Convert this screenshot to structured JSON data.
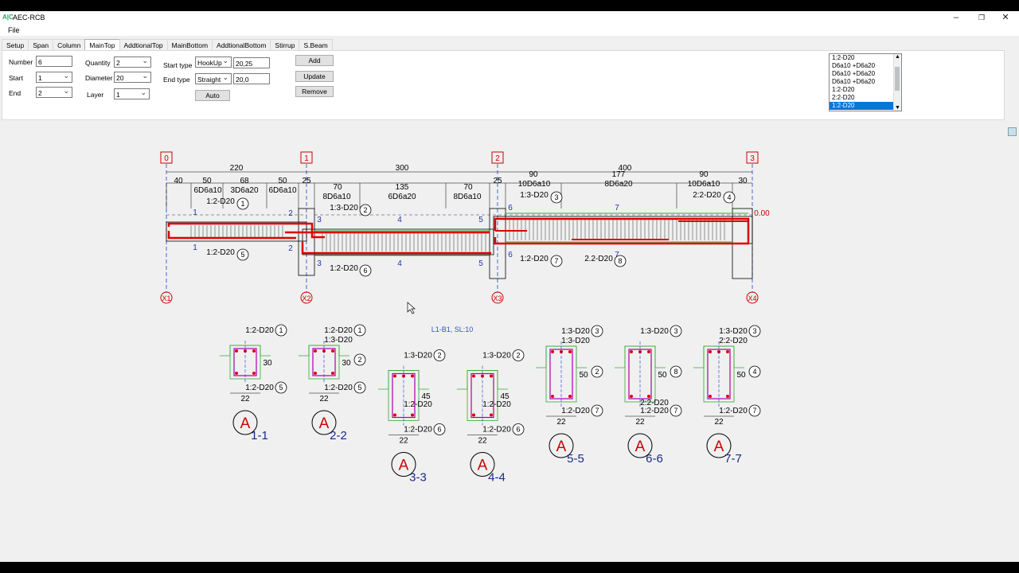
{
  "window": {
    "title": "AEC-RCB",
    "icon_text": "A|C"
  },
  "menu": {
    "file": "File"
  },
  "tabs": [
    "Setup",
    "Span",
    "Column",
    "MainTop",
    "AddtionalTop",
    "MainBottom",
    "AddtionalBottom",
    "Stirrup",
    "S.Beam"
  ],
  "active_tab": "MainTop",
  "form": {
    "number_label": "Number",
    "number_value": "6",
    "start_label": "Start",
    "start_value": "1",
    "end_label": "End",
    "end_value": "2",
    "quantity_label": "Quantity",
    "quantity_value": "2",
    "diameter_label": "Diameter",
    "diameter_value": "20",
    "layer_label": "Layer",
    "layer_value": "1",
    "start_type_label": "Start type",
    "start_type_value": "HookUp",
    "start_type_text": "20,25",
    "end_type_label": "End type",
    "end_type_value": "Straight",
    "end_type_text": "20,0",
    "auto_button": "Auto",
    "add_button": "Add",
    "update_button": "Update",
    "remove_button": "Remove"
  },
  "list_items": [
    "1:2-D20",
    "D6a10 +D6a20",
    "D6a10 +D6a20",
    "D6a10 +D6a20",
    "1:2-D20",
    "2:2-D20",
    "1:2-D20"
  ],
  "list_selected_index": 6,
  "drawing": {
    "grid_labels": [
      "0",
      "1",
      "2",
      "3"
    ],
    "axis_labels": [
      "X1",
      "X2",
      "X3",
      "X4"
    ],
    "span_dims": [
      "220",
      "300",
      "400"
    ],
    "sub_dims_1": [
      "40",
      "50",
      "68",
      "50",
      "25"
    ],
    "sub_dims_2": [
      "70",
      "135",
      "70",
      "25"
    ],
    "sub_dims_3": [
      "90",
      "177",
      "90",
      "30"
    ],
    "stirrup_labels": [
      "6D6a10",
      "3D6a20",
      "6D6a10",
      "8D6a10",
      "6D6a20",
      "8D6a10",
      "10D6a10",
      "8D6a20",
      "10D6a10"
    ],
    "level_text": "0.00",
    "rebar_labels": [
      "1:2-D20",
      "1:2-D20",
      "1:3-D20",
      "1:2-D20",
      "1:3-D20",
      "1:2-D20",
      "2.2-D20",
      "2:2-D20"
    ],
    "rebar_marks": [
      "1",
      "5",
      "2",
      "6",
      "3",
      "7",
      "8",
      "4"
    ],
    "section_marks": [
      "1",
      "1",
      "2",
      "2",
      "3",
      "3",
      "4",
      "4",
      "5",
      "5",
      "6",
      "6",
      "7",
      "7"
    ],
    "caption": "L1-B1, SL:10",
    "sections": [
      {
        "name": "1-1",
        "width": "22",
        "height": "30",
        "top": "1:2-D20",
        "bottom": "1:2-D20",
        "marks": [
          "1",
          "5"
        ]
      },
      {
        "name": "2-2",
        "width": "22",
        "height": "30",
        "top": "1:2-D20",
        "top2": "1:3-D20",
        "bottom": "1:2-D20",
        "marks": [
          "1",
          "2",
          "5"
        ]
      },
      {
        "name": "3-3",
        "width": "22",
        "height": "45",
        "top": "1:3-D20",
        "mid": "1:2-D20",
        "bottom": "1:2-D20",
        "marks": [
          "2",
          "6"
        ]
      },
      {
        "name": "4-4",
        "width": "22",
        "height": "45",
        "top": "1:3-D20",
        "mid": "1:2-D20",
        "bottom": "1:2-D20",
        "marks": [
          "2",
          "6"
        ]
      },
      {
        "name": "5-5",
        "width": "22",
        "height": "50",
        "top": "1:3-D20",
        "top2": "1:3-D20",
        "bottom": "1:2-D20",
        "marks": [
          "3",
          "2",
          "7"
        ]
      },
      {
        "name": "6-6",
        "width": "22",
        "height": "50",
        "top": "1:3-D20",
        "bottom": "1:2-D20",
        "bottom2": "2:2-D20",
        "marks": [
          "3",
          "8",
          "7"
        ]
      },
      {
        "name": "7-7",
        "width": "22",
        "height": "50",
        "top": "1:3-D20",
        "top2": "2:2-D20",
        "bottom": "1:2-D20",
        "marks": [
          "3",
          "4",
          "7"
        ]
      }
    ],
    "section_symbol": "A"
  }
}
